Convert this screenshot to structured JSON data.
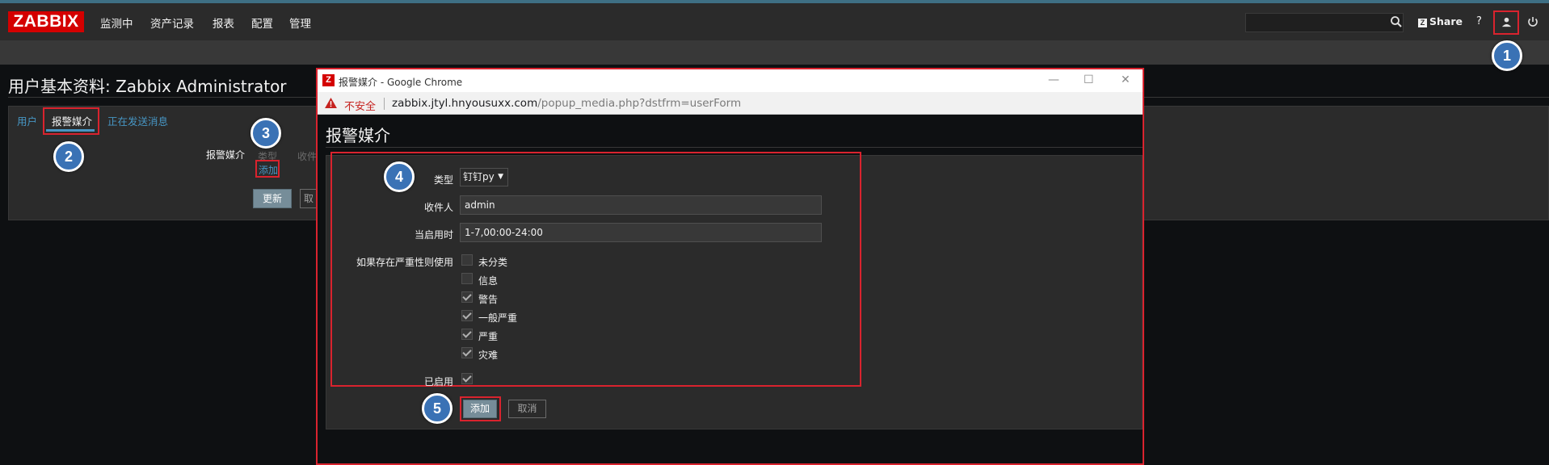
{
  "nav": {
    "logo": "ZABBIX",
    "menu": [
      "监测中",
      "资产记录",
      "报表",
      "配置",
      "管理"
    ],
    "search_value": "",
    "share": "Share",
    "help": "?"
  },
  "page": {
    "title": "用户基本资料: Zabbix Administrator",
    "tabs": [
      "用户",
      "报警媒介",
      "正在发送消息"
    ],
    "media_label": "报警媒介",
    "col_type": "类型",
    "col_to": "收件",
    "add_link": "添加",
    "update_button": "更新",
    "cancel_button": "取"
  },
  "callouts": [
    "1",
    "2",
    "3",
    "4",
    "5"
  ],
  "popup": {
    "window_title": "报警媒介 - Google Chrome",
    "insecure": "不安全",
    "url_host": "zabbix.jtyl.hnyousuxx.com",
    "url_path": "/popup_media.php?dstfrm=userForm",
    "heading": "报警媒介",
    "form": {
      "type_label": "类型",
      "type_value": "钉钉py",
      "to_label": "收件人",
      "to_value": "admin",
      "when_label": "当启用时",
      "when_value": "1-7,00:00-24:00",
      "severity_label": "如果存在严重性则使用",
      "severities": [
        {
          "label": "未分类",
          "checked": false
        },
        {
          "label": "信息",
          "checked": false
        },
        {
          "label": "警告",
          "checked": true
        },
        {
          "label": "一般严重",
          "checked": true
        },
        {
          "label": "严重",
          "checked": true
        },
        {
          "label": "灾难",
          "checked": true
        }
      ],
      "enabled_label": "已启用",
      "enabled_checked": true
    },
    "add_button": "添加",
    "cancel_button": "取消"
  },
  "colors": {
    "accent_red": "#d9232e",
    "link_blue": "#4796c4",
    "callout_blue": "#3a72b5",
    "logo_red": "#d40000"
  }
}
